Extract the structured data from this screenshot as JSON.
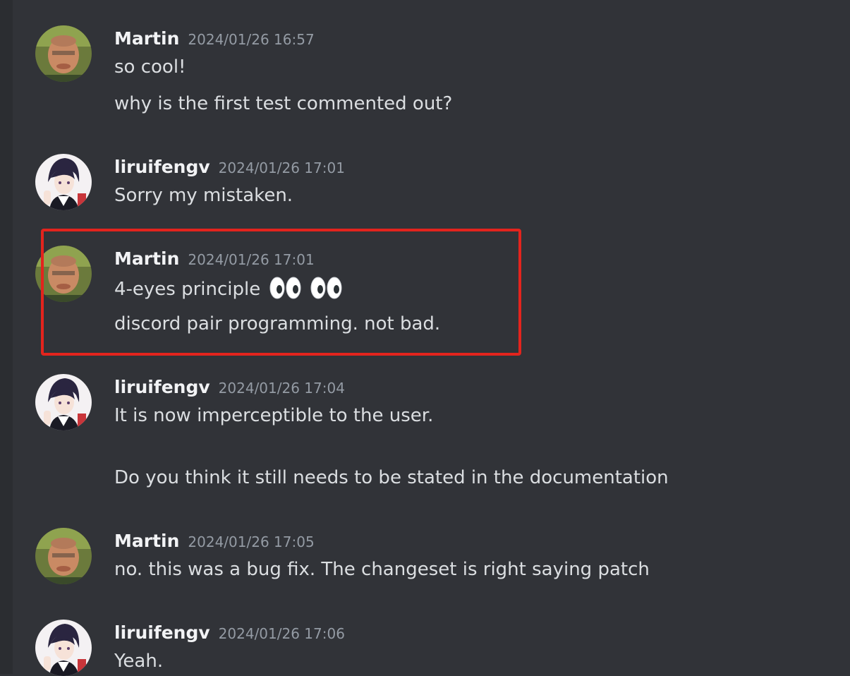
{
  "messages": [
    {
      "author": "Martin",
      "timestamp": "2024/01/26 16:57",
      "avatar_icon": "martin-avatar",
      "lines": [
        "so cool!",
        "why is the first test commented out?"
      ]
    },
    {
      "author": "liruifengv",
      "timestamp": "2024/01/26 17:01",
      "avatar_icon": "liruifengv-avatar",
      "lines": [
        "Sorry my mistaken."
      ]
    },
    {
      "author": "Martin",
      "timestamp": "2024/01/26 17:01",
      "avatar_icon": "martin-avatar",
      "lines": [
        "4-eyes principle",
        "discord pair programming. not bad."
      ],
      "emoji": [
        "eyes-emoji",
        "eyes-emoji"
      ],
      "highlighted": true
    },
    {
      "author": "liruifengv",
      "timestamp": "2024/01/26 17:04",
      "avatar_icon": "liruifengv-avatar",
      "lines": [
        "It is now imperceptible to the user.",
        "Do you think it still needs to be stated in the documentation"
      ]
    },
    {
      "author": "Martin",
      "timestamp": "2024/01/26 17:05",
      "avatar_icon": "martin-avatar",
      "lines": [
        "no. this was a bug fix. The changeset is right saying patch"
      ]
    },
    {
      "author": "liruifengv",
      "timestamp": "2024/01/26 17:06",
      "avatar_icon": "liruifengv-avatar",
      "lines": [
        "Yeah."
      ]
    }
  ],
  "colors": {
    "background": "#313338",
    "highlight_border": "#e3241d",
    "username": "#f2f3f5",
    "timestamp": "#949ba4",
    "message_text": "#dbdee1"
  }
}
